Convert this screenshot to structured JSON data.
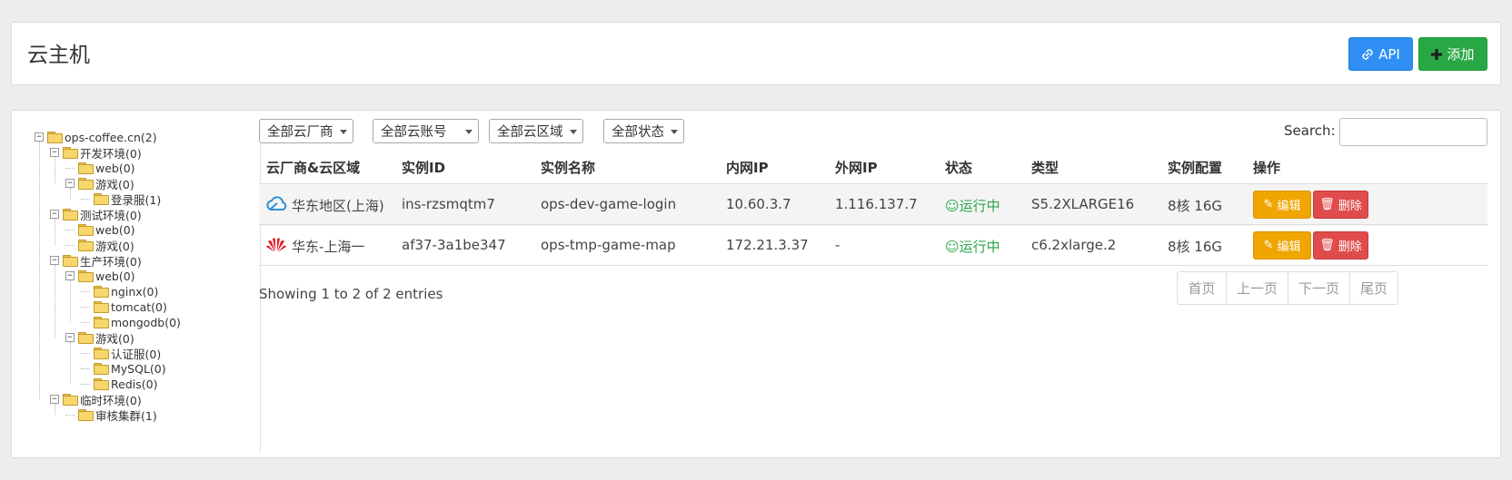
{
  "header": {
    "title": "云主机",
    "api_label": "API",
    "add_label": "添加",
    "api_color": "#2f8ff5",
    "add_color": "#28a745"
  },
  "tree": {
    "nodes": [
      {
        "label": "ops-coffee.cn(2)",
        "depth": 0,
        "toggle": "−"
      },
      {
        "label": "开发环境(0)",
        "depth": 1,
        "toggle": "−"
      },
      {
        "label": "web(0)",
        "depth": 2,
        "toggle": ""
      },
      {
        "label": "游戏(0)",
        "depth": 2,
        "toggle": "−"
      },
      {
        "label": "登录服(1)",
        "depth": 3,
        "toggle": ""
      },
      {
        "label": "测试环境(0)",
        "depth": 1,
        "toggle": "−"
      },
      {
        "label": "web(0)",
        "depth": 2,
        "toggle": ""
      },
      {
        "label": "游戏(0)",
        "depth": 2,
        "toggle": ""
      },
      {
        "label": "生产环境(0)",
        "depth": 1,
        "toggle": "−"
      },
      {
        "label": "web(0)",
        "depth": 2,
        "toggle": "−"
      },
      {
        "label": "nginx(0)",
        "depth": 3,
        "toggle": ""
      },
      {
        "label": "tomcat(0)",
        "depth": 3,
        "toggle": ""
      },
      {
        "label": "mongodb(0)",
        "depth": 3,
        "toggle": ""
      },
      {
        "label": "游戏(0)",
        "depth": 2,
        "toggle": "−"
      },
      {
        "label": "认证服(0)",
        "depth": 3,
        "toggle": ""
      },
      {
        "label": "MySQL(0)",
        "depth": 3,
        "toggle": ""
      },
      {
        "label": "Redis(0)",
        "depth": 3,
        "toggle": ""
      },
      {
        "label": "临时环境(0)",
        "depth": 1,
        "toggle": "−"
      },
      {
        "label": "审核集群(1)",
        "depth": 2,
        "toggle": ""
      }
    ]
  },
  "filters": {
    "provider": "全部云厂商",
    "account": "全部云账号",
    "region": "全部云区域",
    "status": "全部状态",
    "search_label": "Search:",
    "search_value": ""
  },
  "table": {
    "headers": [
      "云厂商&云区域",
      "实例ID",
      "实例名称",
      "内网IP",
      "外网IP",
      "状态",
      "类型",
      "实例配置",
      "操作"
    ],
    "rows": [
      {
        "provider_icon": "tencent-cloud-icon",
        "region": "华东地区(上海)",
        "instance_id": "ins-rzsmqtm7",
        "name": "ops-dev-game-login",
        "private_ip": "10.60.3.7",
        "public_ip": "1.116.137.7",
        "status": "运行中",
        "type": "S5.2XLARGE16",
        "config": "8核 16G",
        "edit_label": "编辑",
        "delete_label": "删除"
      },
      {
        "provider_icon": "huawei-cloud-icon",
        "region": "华东-上海一",
        "instance_id": "af37-3a1be347",
        "name": "ops-tmp-game-map",
        "private_ip": "172.21.3.37",
        "public_ip": "-",
        "status": "运行中",
        "type": "c6.2xlarge.2",
        "config": "8核 16G",
        "edit_label": "编辑",
        "delete_label": "删除"
      }
    ]
  },
  "footer": {
    "showing": "Showing 1 to 2 of 2 entries",
    "pager": {
      "first": "首页",
      "prev": "上一页",
      "next": "下一页",
      "last": "尾页"
    }
  }
}
